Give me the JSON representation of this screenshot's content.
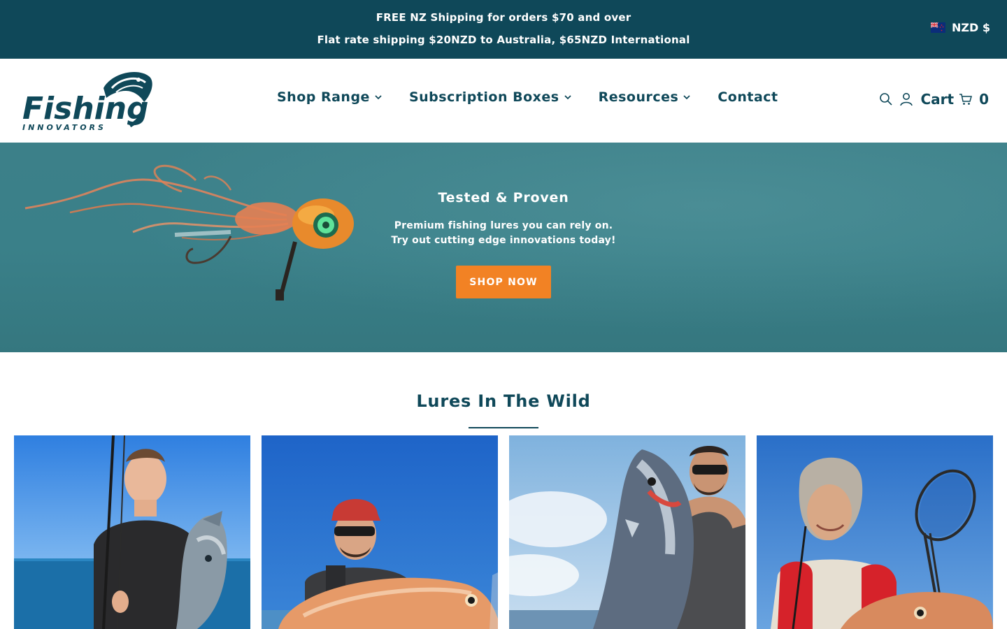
{
  "announcement": {
    "line1": "FREE NZ Shipping for orders $70 and over",
    "line2": "Flat rate shipping $20NZD to Australia, $65NZD International",
    "currency": "NZD $",
    "currency_flag": "nz-flag-icon"
  },
  "header": {
    "logo_word": "Fishing",
    "logo_tagline": "INNOVATORS",
    "nav": [
      {
        "label": "Shop Range",
        "has_dropdown": true
      },
      {
        "label": "Subscription Boxes",
        "has_dropdown": true
      },
      {
        "label": "Resources",
        "has_dropdown": true
      },
      {
        "label": "Contact",
        "has_dropdown": false
      }
    ],
    "cart_label": "Cart",
    "cart_count": "0",
    "icons": [
      "search-icon",
      "account-icon",
      "cart-icon"
    ]
  },
  "hero": {
    "title": "Tested & Proven",
    "subtitle_line1": "Premium fishing lures you can rely on.",
    "subtitle_line2": "Try out cutting edge innovations today!",
    "cta": "SHOP NOW"
  },
  "gallery": {
    "title": "Lures In The Wild",
    "photos": [
      {
        "subject": "young man holding a kingfish on a boat"
      },
      {
        "subject": "man in cap holding a large snapper"
      },
      {
        "subject": "man holding a large kingfish"
      },
      {
        "subject": "woman holding a snapper beside a landing net"
      }
    ]
  },
  "colors": {
    "brand_dark": "#0f4859",
    "hero_teal": "#3a8089",
    "cta_orange": "#f28224",
    "white": "#ffffff"
  }
}
